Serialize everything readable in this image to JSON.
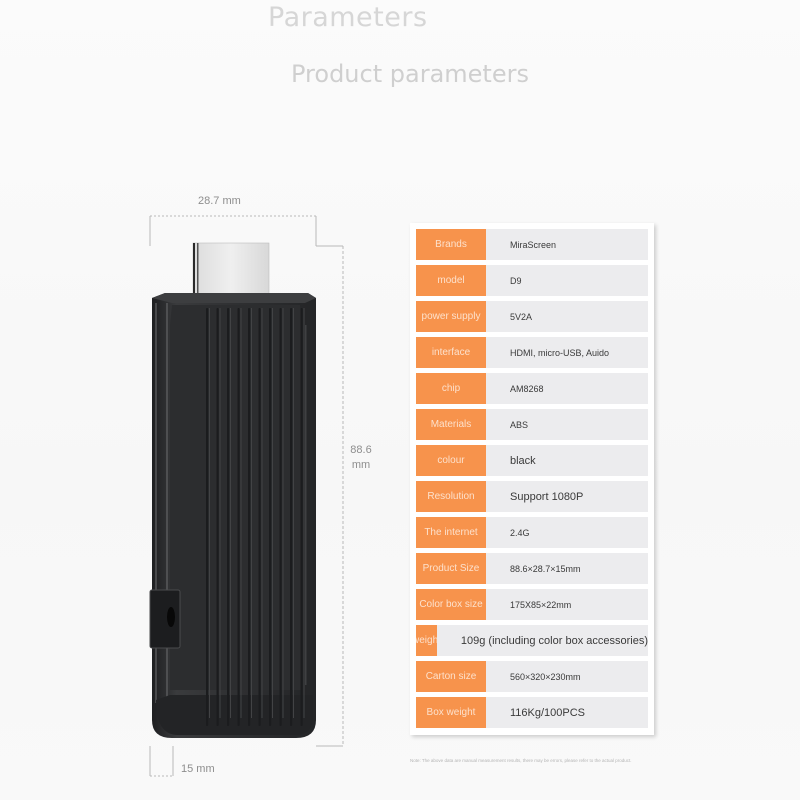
{
  "header": {
    "title": "Parameters",
    "subtitle": "Product parameters"
  },
  "dimensions": {
    "width": "28.7 mm",
    "height_value": "88.6",
    "height_unit": "mm",
    "depth": "15 mm"
  },
  "specs": [
    {
      "key": "Brands",
      "value": "MiraScreen",
      "size": "small"
    },
    {
      "key": "model",
      "value": "D9",
      "size": "small"
    },
    {
      "key": "power supply",
      "value": "5V2A",
      "size": "small"
    },
    {
      "key": "interface",
      "value": "HDMI, micro-USB, Auido",
      "size": "small"
    },
    {
      "key": "chip",
      "value": "AM8268",
      "size": "small"
    },
    {
      "key": "Materials",
      "value": "ABS",
      "size": "small"
    },
    {
      "key": "colour",
      "value": "black",
      "size": "big"
    },
    {
      "key": "Resolution",
      "value": "Support 1080P",
      "size": "big"
    },
    {
      "key": "The internet",
      "value": "2.4G",
      "size": "small"
    },
    {
      "key": "Product Size",
      "value": "88.6×28.7×15mm",
      "size": "small"
    },
    {
      "key": "Color box size",
      "value": "175X85×22mm",
      "size": "small"
    },
    {
      "key": "weight",
      "value": "109g (including color box accessories)",
      "size": "big"
    },
    {
      "key": "Carton size",
      "value": "560×320×230mm",
      "size": "small"
    },
    {
      "key": "Box weight",
      "value": "116Kg/100PCS",
      "size": "big"
    }
  ],
  "note": "Note: The above data are manual measurement results, there may be errors, please refer to the actual product.",
  "colors": {
    "key_background": "#f7934c",
    "value_background": "#ececee",
    "device_body": "#2b2c2e"
  }
}
